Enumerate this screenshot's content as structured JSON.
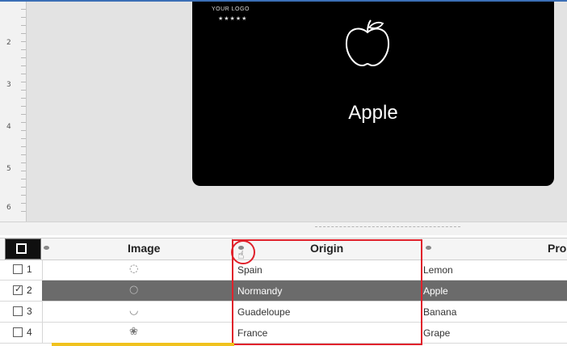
{
  "card": {
    "logo_text": "YOUR LOGO",
    "logo_stars": "★★★★★",
    "icon": "apple-icon",
    "title": "Apple"
  },
  "ruler": {
    "marks": [
      "2",
      "3",
      "4",
      "5",
      "6"
    ]
  },
  "table": {
    "columns": [
      {
        "label": "Image"
      },
      {
        "label": "Origin"
      },
      {
        "label": "Pro"
      }
    ],
    "rows": [
      {
        "num": "1",
        "checked": false,
        "image_icon": "lemon-icon",
        "origin": "Spain",
        "product": "Lemon"
      },
      {
        "num": "2",
        "checked": true,
        "image_icon": "apple-icon",
        "origin": "Normandy",
        "product": "Apple"
      },
      {
        "num": "3",
        "checked": false,
        "image_icon": "banana-icon",
        "origin": "Guadeloupe",
        "product": "Banana"
      },
      {
        "num": "4",
        "checked": false,
        "image_icon": "grape-icon",
        "origin": "France",
        "product": "Grape"
      }
    ],
    "check_glyph": "✓",
    "cursor_glyph": "☝"
  },
  "colors": {
    "highlight": "#e0212b",
    "selected_row": "#6b6b6b",
    "accent_bar": "#f0c21e"
  }
}
